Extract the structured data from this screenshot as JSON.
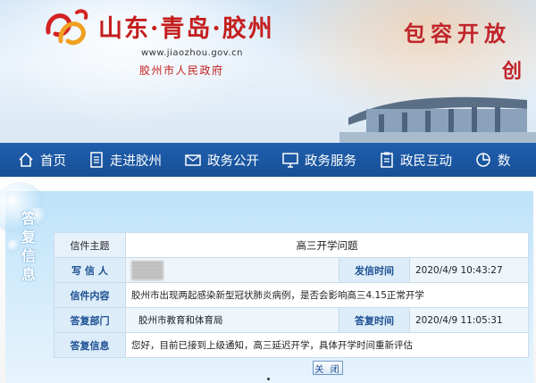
{
  "header": {
    "title": "山东·青岛·胶州",
    "url": "www.jiaozhou.gov.cn",
    "gov_name": "胶州市人民政府",
    "slogan": "包容开放",
    "slogan_partial": "创"
  },
  "nav": {
    "items": [
      {
        "label": "首页",
        "icon": "home-icon"
      },
      {
        "label": "走进胶州",
        "icon": "document-icon"
      },
      {
        "label": "政务公开",
        "icon": "mail-icon"
      },
      {
        "label": "政务服务",
        "icon": "monitor-icon"
      },
      {
        "label": "政民互动",
        "icon": "clipboard-icon"
      },
      {
        "label": "数",
        "icon": "data-icon"
      }
    ],
    "bg_color": "#1f5fae"
  },
  "panel": {
    "side_label": "答复信息"
  },
  "letter": {
    "subject_label": "信件主题",
    "subject": "高三开学问题",
    "writer_label": "写 信 人",
    "sent_time_label": "发信时间",
    "sent_time": "2020/4/9 10:43:27",
    "content_label": "信件内容",
    "content": "胶州市出现两起感染新型冠状肺炎病例，是否会影响高三4.15正常开学",
    "reply_dept_label": "答复部门",
    "reply_dept": "胶州市教育和体育局",
    "reply_time_label": "答复时间",
    "reply_time": "2020/4/9 11:05:31",
    "reply_label": "答复信息",
    "reply": "您好，目前已接到上级通知，高三延迟开学，具体开学时间重新评估"
  },
  "close_button": "关 闭",
  "colors": {
    "accent_red": "#c41e1e",
    "nav_blue": "#1f5fae",
    "label_blue": "#1d4f92"
  }
}
